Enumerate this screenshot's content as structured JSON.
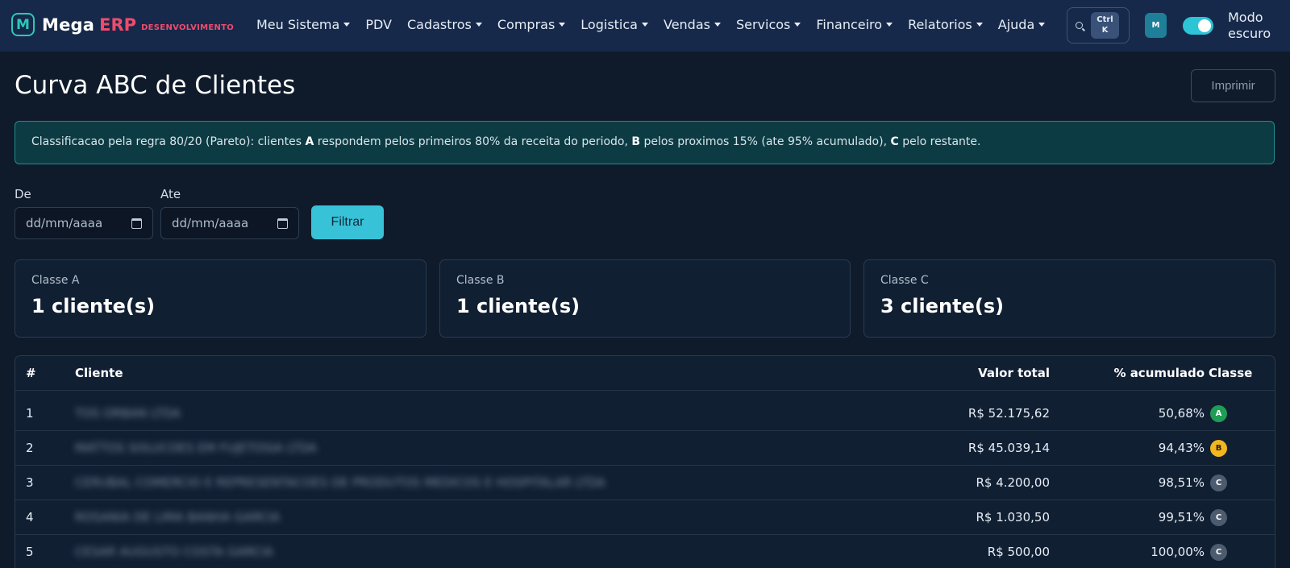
{
  "brand": {
    "logo_letter": "M",
    "name": "Mega",
    "accent": "ERP",
    "env": "DESENVOLVIMENTO"
  },
  "nav": {
    "items": [
      {
        "label": "Meu Sistema",
        "dropdown": true
      },
      {
        "label": "PDV",
        "dropdown": false
      },
      {
        "label": "Cadastros",
        "dropdown": true
      },
      {
        "label": "Compras",
        "dropdown": true
      },
      {
        "label": "Logistica",
        "dropdown": true
      },
      {
        "label": "Vendas",
        "dropdown": true
      },
      {
        "label": "Servicos",
        "dropdown": true
      },
      {
        "label": "Financeiro",
        "dropdown": true
      },
      {
        "label": "Relatorios",
        "dropdown": true
      },
      {
        "label": "Ajuda",
        "dropdown": true
      }
    ],
    "search_kbd_1": "Ctrl",
    "search_kbd_2": "K",
    "avatar": "M",
    "theme_toggle_line1": "Modo",
    "theme_toggle_line2": "escuro"
  },
  "page": {
    "title": "Curva ABC de Clientes",
    "print_label": "Imprimir",
    "info": {
      "p1": "Classificacao pela regra 80/20 (Pareto): clientes ",
      "a": "A",
      "p2": " respondem pelos primeiros 80% da receita do periodo, ",
      "b": "B",
      "p3": " pelos proximos 15% (ate 95% acumulado), ",
      "c": "C",
      "p4": " pelo restante."
    },
    "filters": {
      "from_label": "De",
      "to_label": "Ate",
      "from_placeholder": "dd/mm/aaaa",
      "to_placeholder": "dd/mm/aaaa",
      "submit_label": "Filtrar"
    },
    "cards": [
      {
        "label": "Classe A",
        "value": "1 cliente(s)"
      },
      {
        "label": "Classe B",
        "value": "1 cliente(s)"
      },
      {
        "label": "Classe C",
        "value": "3 cliente(s)"
      }
    ],
    "table": {
      "headers": {
        "num": "#",
        "client": "Cliente",
        "total": "Valor total",
        "cumulative": "% acumulado",
        "class": "Classe"
      },
      "rows": [
        {
          "num": "1",
          "client": "TOS ORBAN LTDA",
          "total": "R$ 52.175,62",
          "cumulative": "50,68%",
          "class": "A"
        },
        {
          "num": "2",
          "client": "MATTOS SOLUCOES EM FUJETOSIA LTDA",
          "total": "R$ 45.039,14",
          "cumulative": "94,43%",
          "class": "B"
        },
        {
          "num": "3",
          "client": "CERUBAL COMERCIO E REPRESENTACOES DE PRODUTOS MEDICOS E HOSPITALAR LTDA",
          "total": "R$ 4.200,00",
          "cumulative": "98,51%",
          "class": "C"
        },
        {
          "num": "4",
          "client": "ROSANIA DE LIMA BANHA GARCIA",
          "total": "R$ 1.030,50",
          "cumulative": "99,51%",
          "class": "C"
        },
        {
          "num": "5",
          "client": "CESAR AUGUSTO COSTA GARCIA",
          "total": "R$ 500,00",
          "cumulative": "100,00%",
          "class": "C"
        }
      ]
    },
    "class_colors": {
      "A": "#1f9d55",
      "B": "#f2b61f",
      "C": "#4d5b6e"
    }
  }
}
